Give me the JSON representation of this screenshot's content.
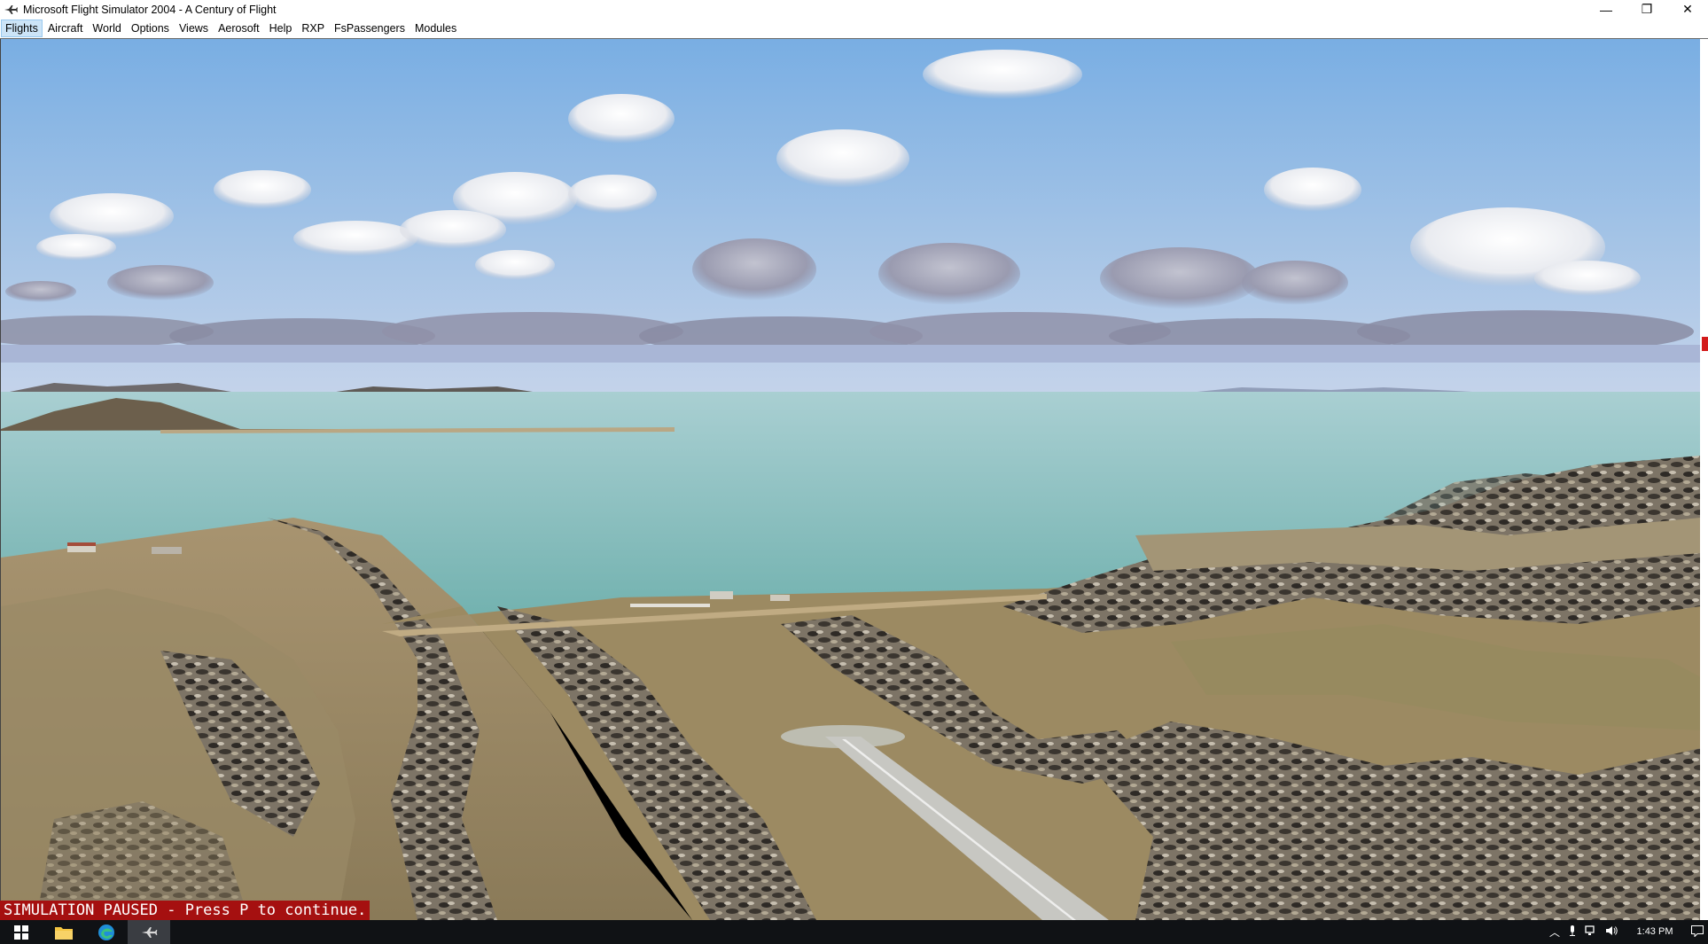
{
  "window": {
    "title": "Microsoft Flight Simulator 2004 - A Century of Flight",
    "controls": {
      "minimize": "—",
      "restore": "❐",
      "close": "✕"
    }
  },
  "menu": {
    "items": [
      {
        "label": "Flights",
        "active": true
      },
      {
        "label": "Aircraft"
      },
      {
        "label": "World"
      },
      {
        "label": "Options"
      },
      {
        "label": "Views"
      },
      {
        "label": "Aerosoft"
      },
      {
        "label": "Help"
      },
      {
        "label": "RXP"
      },
      {
        "label": "FsPassengers"
      },
      {
        "label": "Modules"
      }
    ]
  },
  "sim": {
    "status_message": "SIMULATION PAUSED - Press P to continue."
  },
  "taskbar": {
    "apps": [
      {
        "name": "start",
        "icon": "windows-start-icon"
      },
      {
        "name": "file-explorer",
        "icon": "folder-icon"
      },
      {
        "name": "edge",
        "icon": "edge-browser-icon"
      },
      {
        "name": "flight-simulator",
        "icon": "airplane-icon",
        "active": true
      }
    ],
    "tray": {
      "icons": [
        "chevron-up-icon",
        "microphone-icon",
        "network-icon",
        "volume-icon"
      ],
      "time": "1:43 PM",
      "notification_icon": "notification-icon"
    }
  },
  "colors": {
    "sky_top": "#7fb0e0",
    "sky_horizon": "#b9cde6",
    "sea": "#7fb8b4",
    "terrain": "#9b8a62",
    "pause_banner": "#a51010",
    "taskbar": "#101215"
  }
}
